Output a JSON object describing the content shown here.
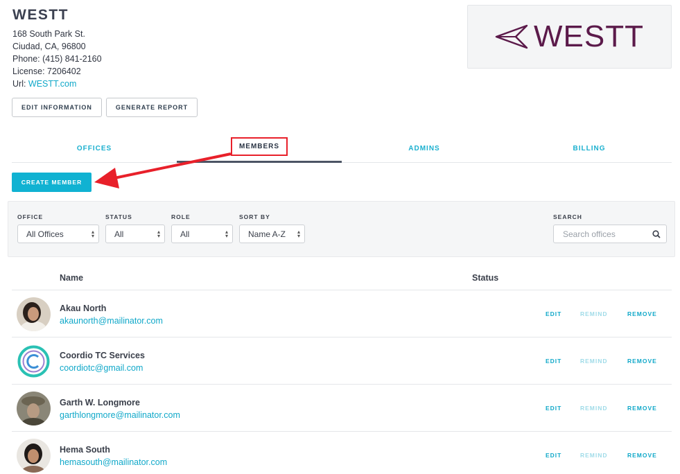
{
  "company": {
    "name": "WESTT",
    "address": "168 South Park St.",
    "city": "Ciudad, CA, 96800",
    "phone": "Phone: (415) 841-2160",
    "license": "License: 7206402",
    "url_label": "Url: ",
    "url": "WESTT.com",
    "logo_text": "WESTT"
  },
  "buttons": {
    "edit_info": "EDIT INFORMATION",
    "generate_report": "GENERATE REPORT",
    "create_member": "CREATE MEMBER"
  },
  "tabs": [
    {
      "label": "OFFICES"
    },
    {
      "label": "MEMBERS"
    },
    {
      "label": "ADMINS"
    },
    {
      "label": "BILLING"
    }
  ],
  "active_tab": "MEMBERS",
  "filters": {
    "office": {
      "label": "OFFICE",
      "value": "All Offices"
    },
    "status": {
      "label": "STATUS",
      "value": "All"
    },
    "role": {
      "label": "ROLE",
      "value": "All"
    },
    "sort": {
      "label": "SORT BY",
      "value": "Name A-Z"
    },
    "search": {
      "label": "SEARCH",
      "placeholder": "Search offices"
    }
  },
  "table": {
    "columns": [
      "Name",
      "Status"
    ],
    "actions": {
      "edit": "EDIT",
      "remind": "REMIND",
      "remove": "REMOVE"
    },
    "rows": [
      {
        "name": "Akau North",
        "email": "akaunorth@mailinator.com"
      },
      {
        "name": "Coordio TC Services",
        "email": "coordiotc@gmail.com"
      },
      {
        "name": "Garth W. Longmore",
        "email": "garthlongmore@mailinator.com"
      },
      {
        "name": "Hema South",
        "email": "hemasouth@mailinator.com"
      }
    ]
  },
  "colors": {
    "accent": "#10b2d2",
    "logo": "#5b1a4a",
    "highlight": "#e8202a"
  }
}
